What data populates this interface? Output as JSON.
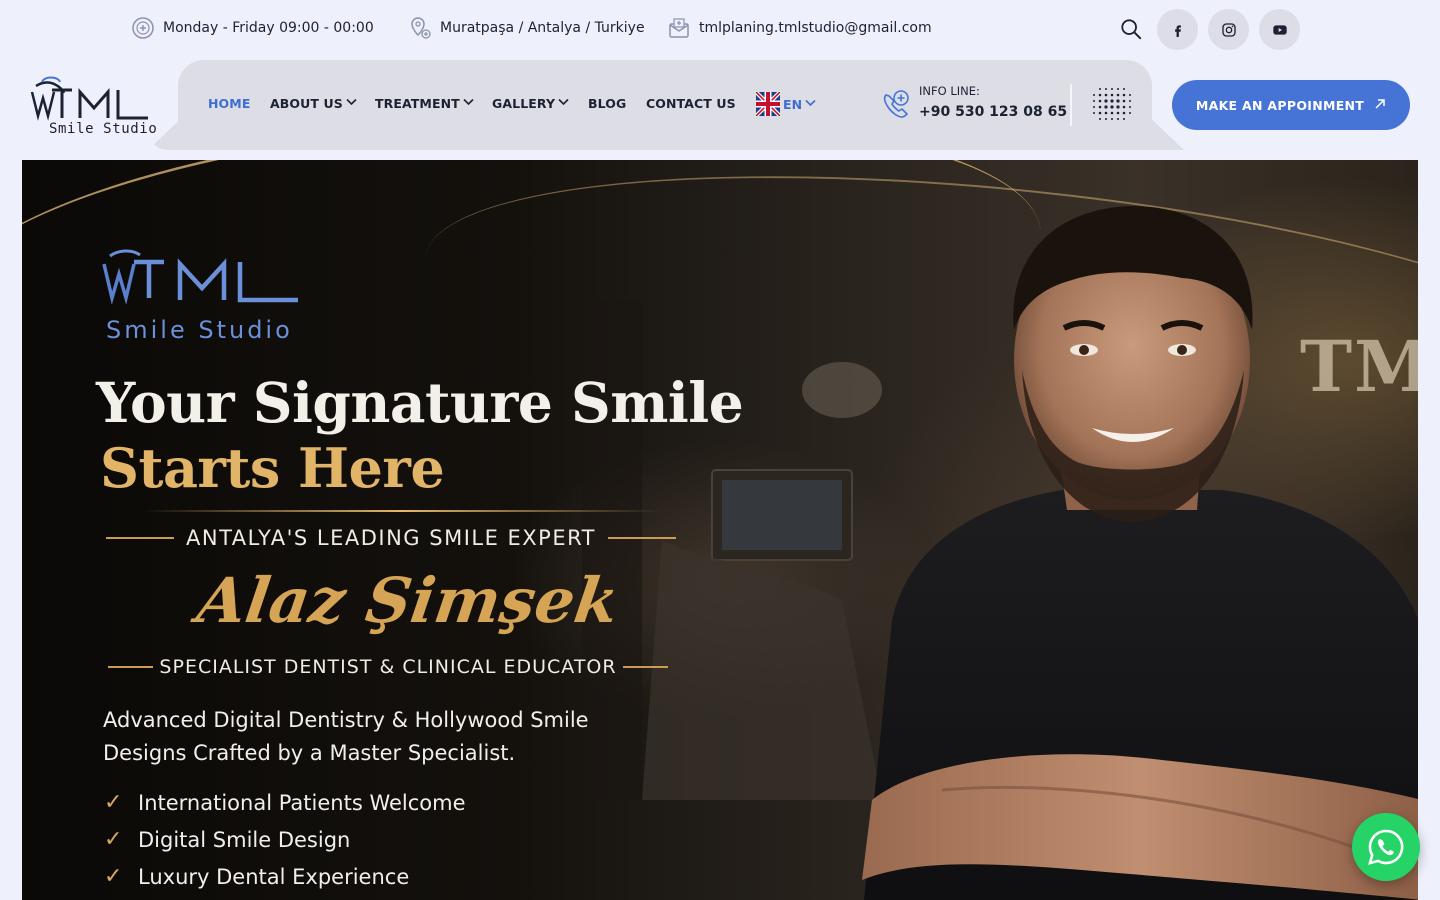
{
  "topbar": {
    "hours": "Monday - Friday 09:00 - 00:00",
    "location": "Muratpaşa / Antalya / Turkiye",
    "email": "tmlplaning.tmlstudio@gmail.com",
    "icons": [
      "clock-icon",
      "location-icon",
      "mail-icon",
      "search-icon",
      "facebook-icon",
      "instagram-icon",
      "youtube-icon"
    ]
  },
  "brand": {
    "logo_sub": "Smile Studio"
  },
  "nav": {
    "items": [
      {
        "label": "HOME",
        "active": true
      },
      {
        "label": "ABOUT US",
        "dropdown": true
      },
      {
        "label": "TREATMENT",
        "dropdown": true
      },
      {
        "label": "GALLERY",
        "dropdown": true
      },
      {
        "label": "BLOG"
      },
      {
        "label": "CONTACT US"
      }
    ],
    "language": "EN",
    "info_label": "INFO LINE:",
    "info_phone": "+90 530 123 08 65",
    "cta_label": "MAKE AN APPOINMENT",
    "accent": "#4673d6"
  },
  "hero": {
    "logo_sub": "Smile Studio",
    "headline_1": "Your Signature Smile",
    "headline_2": "Starts Here",
    "tagline": "ANTALYA'S LEADING SMILE EXPERT",
    "signature": "Alaz Şimşek",
    "role": "SPECIALIST DENTIST & CLINICAL EDUCATOR",
    "description": "Advanced Digital Dentistry & Hollywood Smile Designs Crafted by a Master Specialist.",
    "checks": [
      "International Patients Welcome",
      "Digital Smile Design",
      "Luxury Dental Experience"
    ],
    "gold": "#e2b468"
  },
  "whatsapp": {
    "color": "#25d366"
  }
}
